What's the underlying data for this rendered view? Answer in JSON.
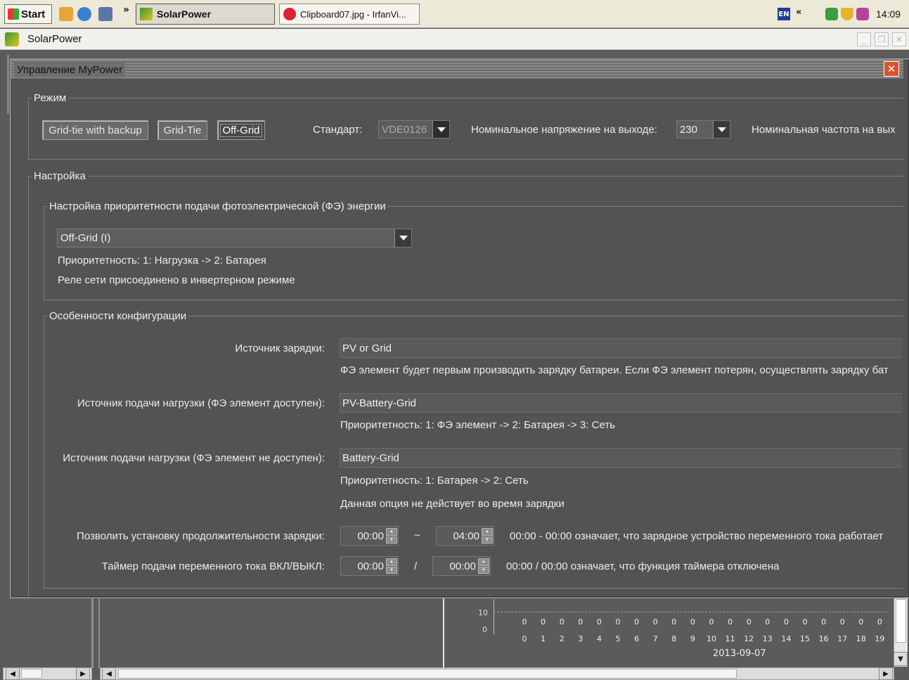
{
  "taskbar": {
    "start_label": "Start",
    "tasks": [
      {
        "label": "SolarPower",
        "active": true
      },
      {
        "label": "Clipboard07.jpg - IrfanVi...",
        "active": false
      }
    ],
    "chevron": "»",
    "tray_lang": "EN",
    "tray_chevron": "«",
    "clock": "14:09"
  },
  "app": {
    "title": "SolarPower",
    "window_controls": {
      "minimize": "_",
      "restore": "❐",
      "close": "✕"
    }
  },
  "dialog": {
    "title": "Управление MyPower",
    "close": "✕",
    "mode": {
      "legend": "Режим",
      "buttons": [
        {
          "label": "Grid-tie with backup"
        },
        {
          "label": "Grid-Tie"
        },
        {
          "label": "Off-Grid",
          "active": true
        }
      ],
      "standard_label": "Стандарт:",
      "standard_value": "VDE0126",
      "voltage_label": "Номинальное напряжение на выходе:",
      "voltage_value": "230",
      "freq_label": "Номинальная частота на вых"
    },
    "settings": {
      "legend": "Настройка",
      "pv_priority": {
        "legend": "Настройка приоритетности подачи фотоэлектрической (ФЭ) энергии",
        "value": "Off-Grid (I)",
        "line1": "Приоритетность: 1: Нагрузка -> 2: Батарея",
        "line2": "Реле сети присоединено в инвертерном режиме"
      },
      "config": {
        "legend": "Особенности конфигурации",
        "charge_source_label": "Источник зарядки:",
        "charge_source_value": "PV or Grid",
        "charge_source_desc": "ФЭ элемент будет первым производить зарядку батареи. Если ФЭ элемент потерян, осуществлять зарядку бат",
        "load_pv_label": "Источник подачи нагрузки (ФЭ элемент доступен):",
        "load_pv_value": "PV-Battery-Grid",
        "load_pv_desc": "Приоритетность: 1: ФЭ элемент -> 2: Батарея -> 3: Сеть",
        "load_nopv_label": "Источник подачи нагрузки (ФЭ элемент не доступен):",
        "load_nopv_value": "Battery-Grid",
        "load_nopv_desc1": "Приоритетность: 1: Батарея -> 2: Сеть",
        "load_nopv_desc2": "Данная опция не действует во время зарядки",
        "charge_duration_label": "Позволить установку продолжительности зарядки:",
        "charge_duration_from": "00:00",
        "charge_duration_sep": "~",
        "charge_duration_to": "04:00",
        "charge_duration_note": "00:00 - 00:00 означает, что зарядное устройство переменного тока работает",
        "ac_timer_label": "Таймер подачи переменного тока ВКЛ/ВЫКЛ:",
        "ac_timer_on": "00:00",
        "ac_timer_sep": "/",
        "ac_timer_off": "00:00",
        "ac_timer_note": "00:00 / 00:00 означает, что функция таймера отключена"
      }
    }
  },
  "background_chart": {
    "y_labels": [
      "10",
      "0"
    ],
    "values": [
      "0",
      "0",
      "0",
      "0",
      "0",
      "0",
      "0",
      "0",
      "0",
      "0",
      "0",
      "0",
      "0",
      "0",
      "0",
      "0",
      "0",
      "0",
      "0",
      "0"
    ],
    "hours": [
      "0",
      "1",
      "2",
      "3",
      "4",
      "5",
      "6",
      "7",
      "8",
      "9",
      "10",
      "11",
      "12",
      "13",
      "14",
      "15",
      "16",
      "17",
      "18",
      "19"
    ],
    "date": "2013-09-07"
  }
}
